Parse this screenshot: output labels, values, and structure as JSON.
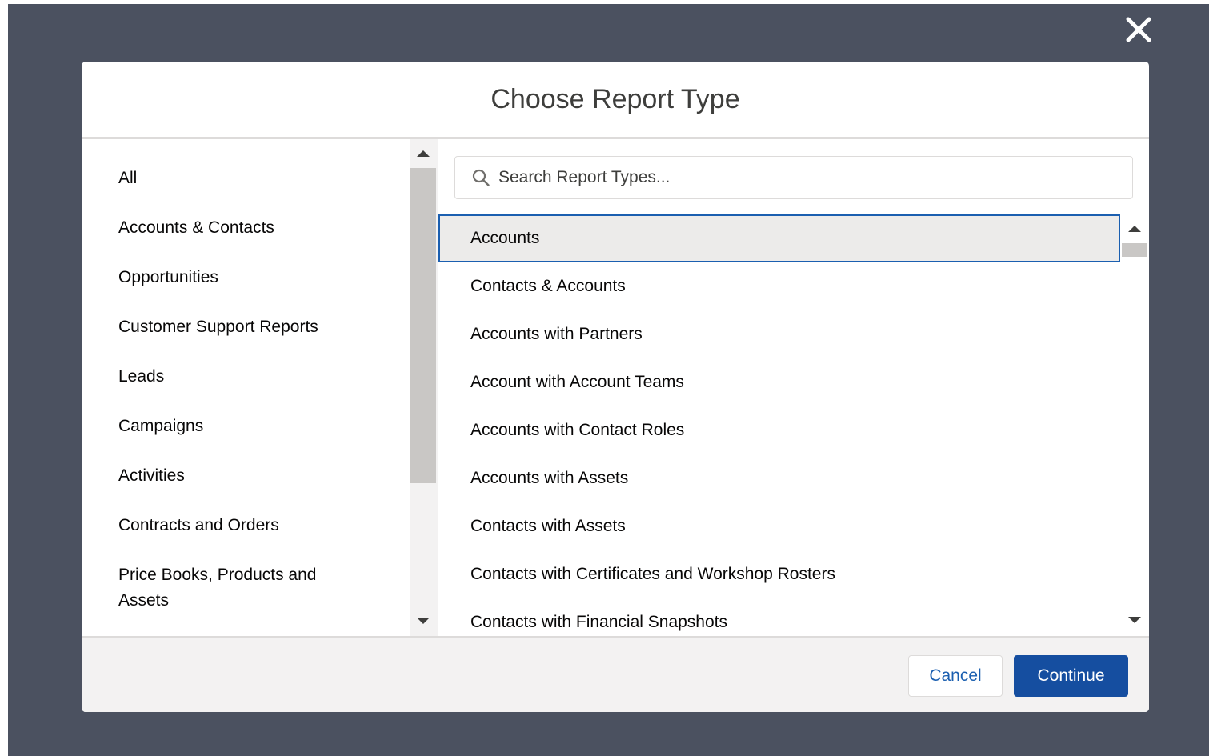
{
  "close": {
    "icon": "close-icon",
    "color": "#ffffff"
  },
  "modal": {
    "title": "Choose Report Type"
  },
  "categories": [
    {
      "label": "All"
    },
    {
      "label": "Accounts & Contacts"
    },
    {
      "label": "Opportunities"
    },
    {
      "label": "Customer Support Reports"
    },
    {
      "label": "Leads"
    },
    {
      "label": "Campaigns"
    },
    {
      "label": "Activities"
    },
    {
      "label": "Contracts and Orders"
    },
    {
      "label": "Price Books, Products and Assets"
    }
  ],
  "search": {
    "icon": "search-icon",
    "placeholder": "Search Report Types...",
    "value": ""
  },
  "report_types": [
    {
      "label": "Accounts",
      "selected": true
    },
    {
      "label": "Contacts & Accounts",
      "selected": false
    },
    {
      "label": "Accounts with Partners",
      "selected": false
    },
    {
      "label": "Account with Account Teams",
      "selected": false
    },
    {
      "label": "Accounts with Contact Roles",
      "selected": false
    },
    {
      "label": "Accounts with Assets",
      "selected": false
    },
    {
      "label": "Contacts with Assets",
      "selected": false
    },
    {
      "label": "Contacts with Certificates and Workshop Rosters",
      "selected": false
    },
    {
      "label": "Contacts with Financial Snapshots",
      "selected": false
    }
  ],
  "footer": {
    "cancel_label": "Cancel",
    "continue_label": "Continue"
  },
  "colors": {
    "backdrop": "#4b5160",
    "brand": "#154ea0",
    "selected_border": "#1b5fb0",
    "selected_bg": "#ecebea"
  }
}
